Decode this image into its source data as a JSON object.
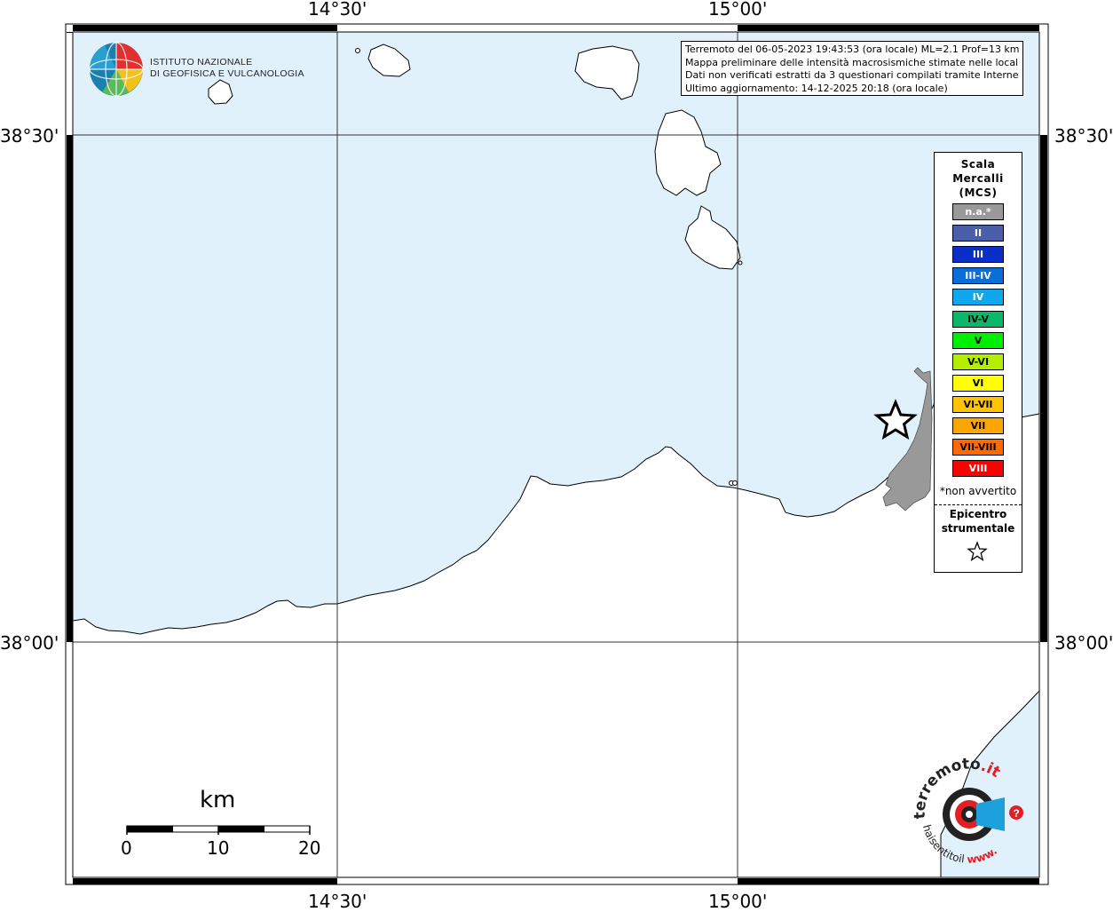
{
  "map": {
    "coords": {
      "top_left_lon": "14°30'",
      "top_right_lon": "15°00'",
      "bottom_left_lon": "14°30'",
      "bottom_right_lon": "15°00'",
      "left_upper_lat": "38°30'",
      "left_lower_lat": "38°00'",
      "right_upper_lat": "38°30'",
      "right_lower_lat": "38°00'"
    },
    "colors": {
      "sea": "#e0f1fb",
      "land": "#ffffff",
      "urban": "#999999",
      "coast": "#000000"
    }
  },
  "logo": {
    "name_line1": "ISTITUTO NAZIONALE",
    "name_line2": "DI GEOFISICA E VULCANOLOGIA",
    "icon": "ingv-globe-icon"
  },
  "info": {
    "line1": "Terremoto del 06-05-2023 19:43:53 (ora locale) ML=2.1 Prof=13 km",
    "line2": "Mappa preliminare delle intensità macrosismiche stimate nelle località",
    "line3": "Dati non verificati estratti da 3 questionari compilati tramite Internet.",
    "line4": "Ultimo aggiornamento: 14-12-2025 20:18 (ora locale)"
  },
  "legend": {
    "title1": "Scala",
    "title2": "Mercalli",
    "title3": "(MCS)",
    "items": [
      {
        "label": "n.a.*",
        "color": "#999999",
        "text_color": "#ffffff"
      },
      {
        "label": "II",
        "color": "#4a5fa8",
        "text_color": "#ffffff"
      },
      {
        "label": "III",
        "color": "#0a2ec8",
        "text_color": "#ffffff"
      },
      {
        "label": "III-IV",
        "color": "#0a6ed8",
        "text_color": "#ffffff"
      },
      {
        "label": "IV",
        "color": "#10a8ec",
        "text_color": "#ffffff"
      },
      {
        "label": "IV-V",
        "color": "#0bb86a",
        "text_color": "#000000"
      },
      {
        "label": "V",
        "color": "#00ee00",
        "text_color": "#000000"
      },
      {
        "label": "V-VI",
        "color": "#b4ee00",
        "text_color": "#000000"
      },
      {
        "label": "VI",
        "color": "#ffff00",
        "text_color": "#000000"
      },
      {
        "label": "VI-VII",
        "color": "#ffc400",
        "text_color": "#000000"
      },
      {
        "label": "VII",
        "color": "#ffa500",
        "text_color": "#000000"
      },
      {
        "label": "VII-VIII",
        "color": "#ff6a00",
        "text_color": "#000000"
      },
      {
        "label": "VIII",
        "color": "#ff0000",
        "text_color": "#ffffff"
      }
    ],
    "note": "*non avvertito",
    "epicenter_line1": "Epicentro",
    "epicenter_line2": "strumentale",
    "epicenter_icon": "star-icon"
  },
  "scale_bar": {
    "unit": "km",
    "ticks": [
      "0",
      "10",
      "20"
    ]
  },
  "badge": {
    "text_brand": "terremoto",
    "text_suffix": ".it",
    "text_question": "haisentitoil",
    "text_www": "www.",
    "icon": "haisentito-logo-icon"
  }
}
